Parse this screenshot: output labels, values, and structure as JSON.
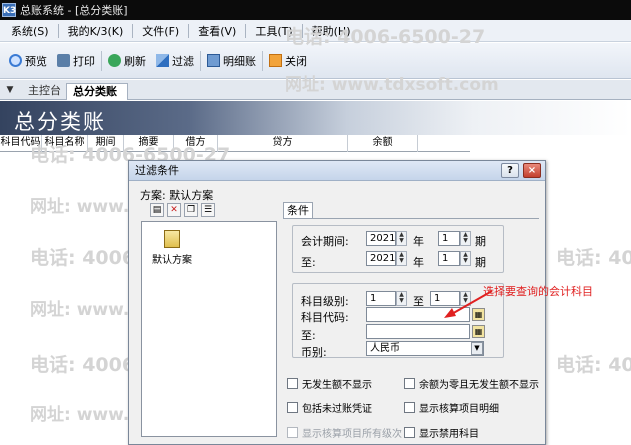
{
  "window": {
    "app_icon": "K3",
    "title": "总账系统 - [总分类账]"
  },
  "menu": [
    {
      "label": "系统(S)"
    },
    {
      "label": "我的K/3(K)"
    },
    {
      "label": "文件(F)"
    },
    {
      "label": "查看(V)"
    },
    {
      "label": "工具(T)"
    },
    {
      "label": "帮助(H)"
    }
  ],
  "toolbar": [
    {
      "label": "预览",
      "icon": "preview-icon"
    },
    {
      "label": "打印",
      "icon": "print-icon"
    },
    {
      "label": "刷新",
      "icon": "refresh-icon"
    },
    {
      "label": "过滤",
      "icon": "filter-icon"
    },
    {
      "label": "明细账",
      "icon": "detail-ledger-icon"
    },
    {
      "label": "关闭",
      "icon": "close-icon"
    }
  ],
  "tabs": {
    "arrow": "▼",
    "main": "主控台",
    "active": "总分类账",
    "close": "×"
  },
  "banner_title": "总分类账",
  "grid_headers": [
    "科目代码",
    "科目名称",
    "期间",
    "摘要",
    "借方",
    "贷方",
    "余额"
  ],
  "watermark": {
    "phone": "电话: 4006-6500-27",
    "site": "网址: www.tdxsoft.com"
  },
  "dialog": {
    "title": "过滤条件",
    "help": "?",
    "close": "×",
    "scheme_label": "方案: 默认方案",
    "scheme_item": "默认方案",
    "tab": "条件",
    "period_label": "会计期间:",
    "to_label": "至:",
    "year_from": "2021",
    "period_from": "1",
    "year_to": "2021",
    "period_to": "1",
    "year_unit": "年",
    "period_unit": "期",
    "level_label": "科目级别:",
    "level_from": "1",
    "level_to": "1",
    "level_to_label": "至",
    "code_label": "科目代码:",
    "code_to_label": "至:",
    "currency_label": "币别:",
    "currency_value": "人民币",
    "checkboxes": [
      {
        "label": "无发生额不显示",
        "checked": false,
        "disabled": false
      },
      {
        "label": "余额为零且无发生额不显示",
        "checked": false,
        "disabled": false
      },
      {
        "label": "包括未过账凭证",
        "checked": false,
        "disabled": false
      },
      {
        "label": "显示核算项目明细",
        "checked": false,
        "disabled": false
      },
      {
        "label": "显示核算项目所有级次",
        "checked": false,
        "disabled": true
      },
      {
        "label": "显示禁用科目",
        "checked": false,
        "disabled": false
      }
    ]
  },
  "annotation": "选择要查询的会计科目",
  "colors": {
    "title_bar": "#0b0b0b",
    "banner_dark": "#34435f",
    "annotation": "#e02020"
  }
}
